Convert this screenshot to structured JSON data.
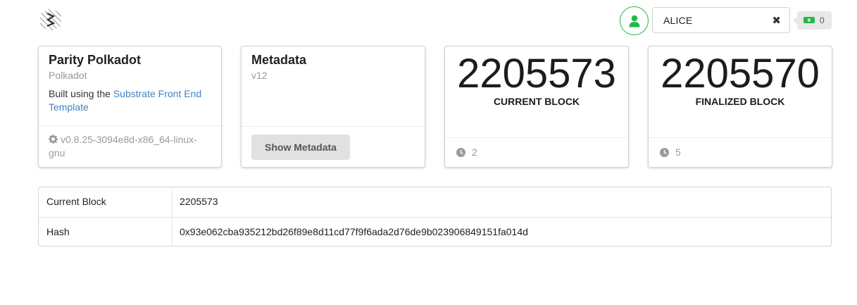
{
  "header": {
    "account": {
      "selected": "ALICE"
    },
    "balance": {
      "count": "0"
    }
  },
  "cards": {
    "node_info": {
      "title": "Parity Polkadot",
      "meta": "Polkadot",
      "desc_prefix": "Built using the ",
      "desc_link": "Substrate Front End Template",
      "version": "v0.8.25-3094e8d-x86_64-linux-gnu"
    },
    "metadata": {
      "title": "Metadata",
      "meta": "v12",
      "button_label": "Show Metadata"
    },
    "current_block": {
      "value": "2205573",
      "label": "CURRENT BLOCK",
      "timer": "2"
    },
    "finalized_block": {
      "value": "2205570",
      "label": "FINALIZED BLOCK",
      "timer": "5"
    }
  },
  "block_table": {
    "rows": [
      {
        "key": "Current Block",
        "value": "2205573"
      },
      {
        "key": "Hash",
        "value": "0x93e062cba935212bd26f89e8d11cd77f9f6ada2d76de9b023906849151fa014d"
      }
    ]
  },
  "colors": {
    "accent_green": "#21ba45",
    "link_blue": "#4183c4"
  }
}
